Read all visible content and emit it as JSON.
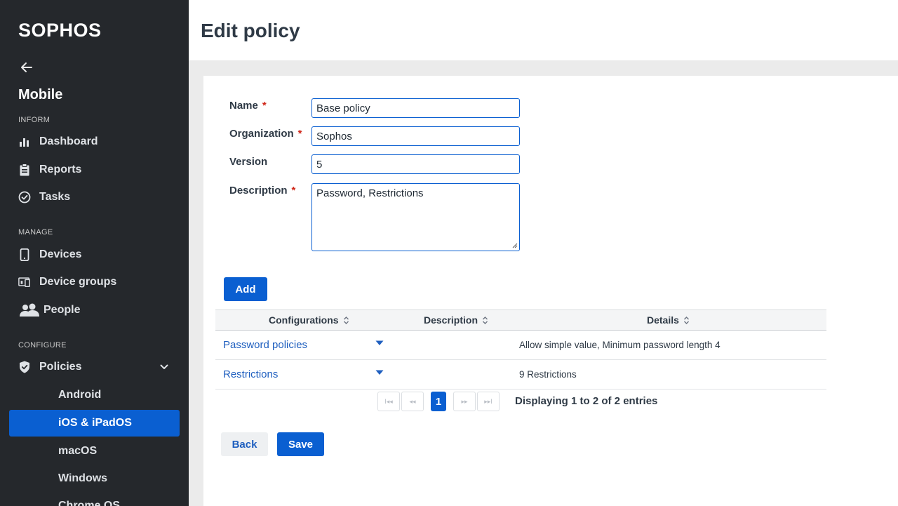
{
  "sidebar": {
    "logo": "SOPHOS",
    "app_title": "Mobile",
    "sections": {
      "inform": "INFORM",
      "manage": "MANAGE",
      "configure": "CONFIGURE"
    },
    "items": {
      "dashboard": "Dashboard",
      "reports": "Reports",
      "tasks": "Tasks",
      "devices": "Devices",
      "device_groups": "Device groups",
      "people": "People",
      "policies": "Policies"
    },
    "policy_subitems": {
      "android": "Android",
      "ios": "iOS & iPadOS",
      "macos": "macOS",
      "windows": "Windows",
      "chromeos": "Chrome OS"
    },
    "active_item": "iOS & iPadOS",
    "accent": "#0a5fd1"
  },
  "header": {
    "title": "Edit policy"
  },
  "form": {
    "name_label": "Name",
    "name_value": "Base policy",
    "org_label": "Organization",
    "org_value": "Sophos",
    "version_label": "Version",
    "version_value": "5",
    "description_label": "Description",
    "description_value": "Password, Restrictions",
    "required_marker": "*"
  },
  "actions": {
    "add": "Add",
    "back": "Back",
    "save": "Save"
  },
  "table": {
    "columns": [
      "Configurations",
      "Description",
      "Details"
    ],
    "rows": [
      {
        "configuration": "Password policies",
        "description": "",
        "details": "Allow simple value, Minimum password length 4"
      },
      {
        "configuration": "Restrictions",
        "description": "",
        "details": "9 Restrictions"
      }
    ]
  },
  "pagination": {
    "current_page": "1",
    "first": "I◂◂",
    "prev": "◂◂",
    "next": "▸▸",
    "last": "▸▸I",
    "info": "Displaying 1 to 2 of 2 entries"
  }
}
